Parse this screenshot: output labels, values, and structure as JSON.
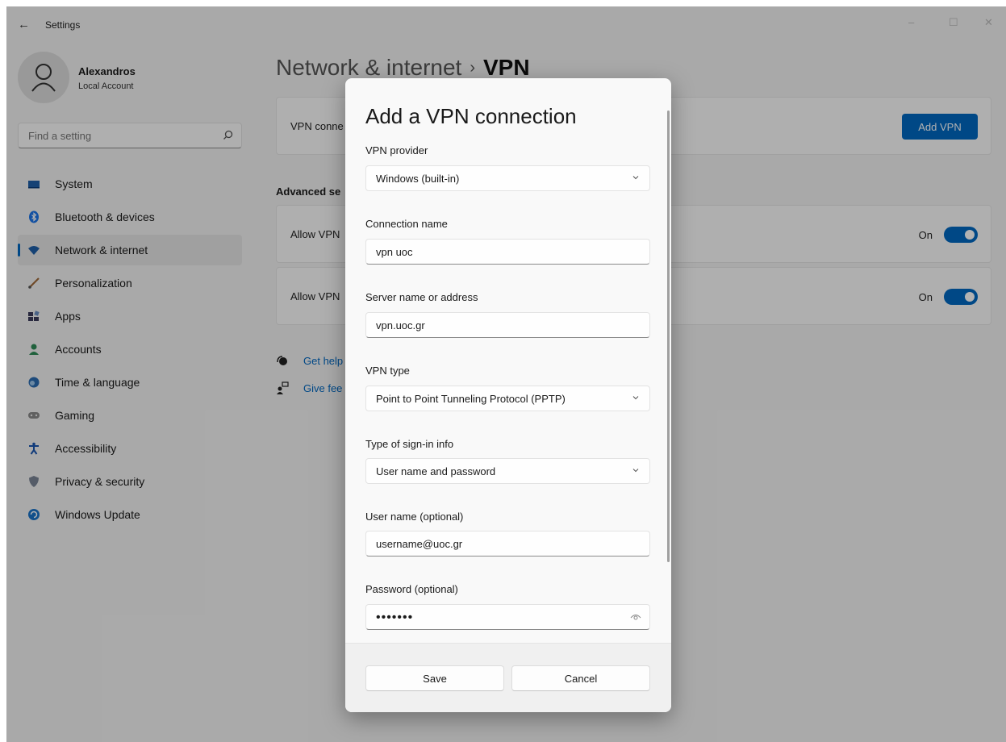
{
  "window": {
    "title": "Settings",
    "controls": [
      "–",
      "☐",
      "✕"
    ]
  },
  "profile": {
    "name": "Alexandros",
    "account_type": "Local Account"
  },
  "search": {
    "placeholder": "Find a setting"
  },
  "sidebar": {
    "items": [
      {
        "label": "System",
        "icon": "system-icon"
      },
      {
        "label": "Bluetooth & devices",
        "icon": "bluetooth-icon"
      },
      {
        "label": "Network & internet",
        "icon": "wifi-icon",
        "selected": true
      },
      {
        "label": "Personalization",
        "icon": "brush-icon"
      },
      {
        "label": "Apps",
        "icon": "apps-icon"
      },
      {
        "label": "Accounts",
        "icon": "person-icon"
      },
      {
        "label": "Time & language",
        "icon": "globe-clock-icon"
      },
      {
        "label": "Gaming",
        "icon": "gamepad-icon"
      },
      {
        "label": "Accessibility",
        "icon": "accessibility-icon"
      },
      {
        "label": "Privacy & security",
        "icon": "shield-icon"
      },
      {
        "label": "Windows Update",
        "icon": "update-icon"
      }
    ]
  },
  "page": {
    "breadcrumb_parent": "Network & internet",
    "breadcrumb_separator": "›",
    "breadcrumb_current": "VPN",
    "vpn_connections_label": "VPN conne",
    "add_vpn_label": "Add VPN",
    "advanced_heading": "Advanced se",
    "toggles": [
      {
        "label": "Allow VPN",
        "state_text": "On",
        "on": true
      },
      {
        "label": "Allow VPN",
        "state_text": "On",
        "on": true
      }
    ],
    "links": [
      {
        "label": "Get help",
        "icon": "help-icon"
      },
      {
        "label": "Give fee",
        "icon": "feedback-icon"
      }
    ]
  },
  "dialog": {
    "title": "Add a VPN connection",
    "fields": {
      "vpn_provider": {
        "label": "VPN provider",
        "value": "Windows (built-in)"
      },
      "connection_name": {
        "label": "Connection name",
        "value": "vpn uoc"
      },
      "server": {
        "label": "Server name or address",
        "value": "vpn.uoc.gr"
      },
      "vpn_type": {
        "label": "VPN type",
        "value": "Point to Point Tunneling Protocol (PPTP)"
      },
      "signin_type": {
        "label": "Type of sign-in info",
        "value": "User name and password"
      },
      "username": {
        "label": "User name (optional)",
        "value": "username@uoc.gr"
      },
      "password": {
        "label": "Password (optional)",
        "value": "•••••••"
      }
    },
    "save_label": "Save",
    "cancel_label": "Cancel"
  },
  "colors": {
    "accent": "#0067c0",
    "background": "#f3f3f3",
    "dialog_background": "#f9f9f9"
  }
}
